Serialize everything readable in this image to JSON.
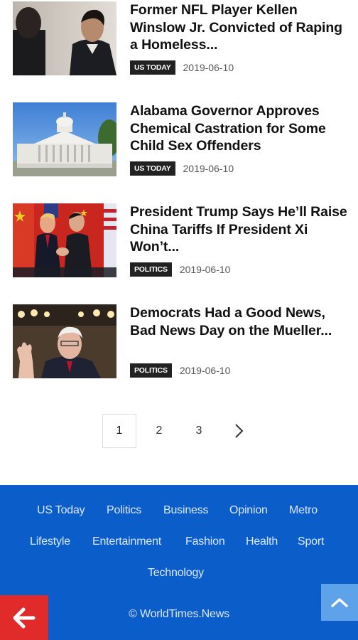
{
  "articles": [
    {
      "headline": "Former NFL Player Kellen Winslow Jr. Convicted of Raping a Homeless...",
      "tag": "US TODAY",
      "date": "2019-06-10",
      "image": "man-in-suit-photo"
    },
    {
      "headline": "Alabama Governor Approves Chemical Castration for Some Child Sex Offenders",
      "tag": "US TODAY",
      "date": "2019-06-10",
      "image": "capitol-building-photo"
    },
    {
      "headline": "President Trump Says He’ll Raise China Tariffs If President Xi Won’t...",
      "tag": "POLITICS",
      "date": "2019-06-10",
      "image": "handshake-flags-photo"
    },
    {
      "headline": "Democrats Had a Good News, Bad News Day on the Mueller...",
      "tag": "POLITICS",
      "date": "2019-06-10",
      "image": "man-raising-hand-photo"
    }
  ],
  "pagination": {
    "pages": [
      "1",
      "2",
      "3"
    ],
    "current": "1",
    "next_icon": "chevron-right-icon"
  },
  "footer": {
    "links": [
      "US Today",
      "Politics",
      "Business",
      "Opinion",
      "Metro",
      "Lifestyle",
      "Entertainment",
      "Fashion",
      "Health",
      "Sport",
      "Technology"
    ],
    "copyright": "© WorldTimes.News",
    "background": "#0b5dca"
  },
  "buttons": {
    "back_icon": "arrow-left-icon",
    "back_color": "#e12b2b",
    "top_icon": "chevron-up-icon",
    "top_color": "#5ea3ea"
  }
}
